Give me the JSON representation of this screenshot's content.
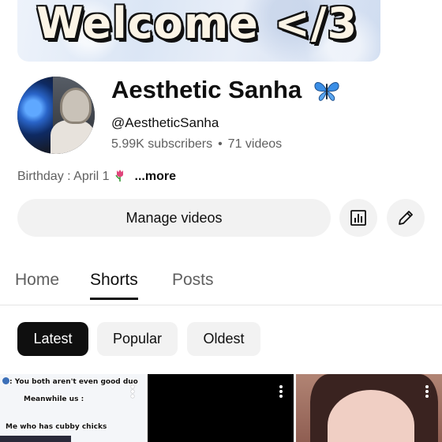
{
  "banner": {
    "text": "Welcome </3"
  },
  "channel": {
    "name": "Aesthetic Sanha",
    "handle": "@AestheticSanha",
    "subscribers": "5.99K subscribers",
    "separator": "•",
    "videos": "71 videos",
    "description": "Birthday : April 1",
    "more_label": "...more"
  },
  "actions": {
    "manage_label": "Manage videos",
    "analytics_icon": "analytics-icon",
    "edit_icon": "pencil-icon"
  },
  "tabs": [
    {
      "label": "Home",
      "active": false
    },
    {
      "label": "Shorts",
      "active": true
    },
    {
      "label": "Posts",
      "active": false
    }
  ],
  "filters": [
    {
      "label": "Latest",
      "active": true
    },
    {
      "label": "Popular",
      "active": false
    },
    {
      "label": "Oldest",
      "active": false
    }
  ],
  "shorts": [
    {
      "caption_lines": [
        ": You both aren't even good duo",
        "Meanwhile us :",
        "Me who has cubby chicks"
      ]
    },
    {
      "caption_lines": []
    },
    {
      "caption_lines": []
    }
  ],
  "colors": {
    "text_primary": "#0f0f0f",
    "text_secondary": "#606060",
    "chip_bg": "#f2f2f2",
    "chip_active_bg": "#0f0f0f",
    "butterfly": "#3a8ee6",
    "tulip": "#e0457b"
  }
}
